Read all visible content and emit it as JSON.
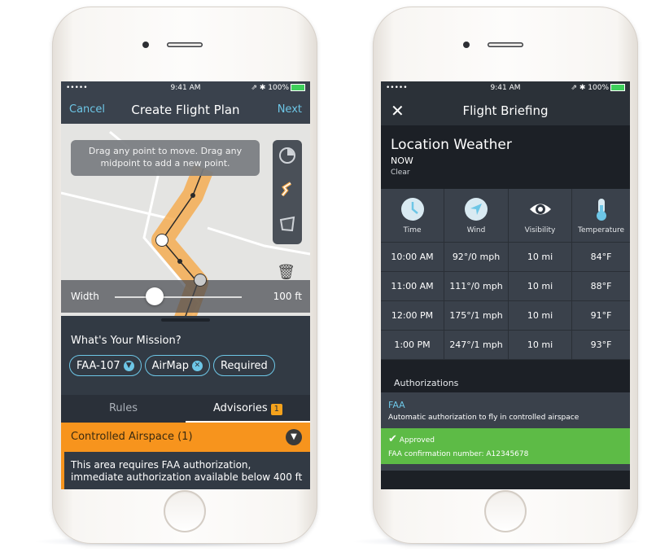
{
  "status_bar": {
    "signal": "••••• ",
    "time": "9:41 AM",
    "battery": "100%"
  },
  "left": {
    "nav": {
      "cancel": "Cancel",
      "title": "Create Flight Plan",
      "next": "Next"
    },
    "map": {
      "tooltip": "Drag any point to move. Drag any midpoint to add a new point.",
      "tools": [
        "circle-tool-icon",
        "path-tool-icon",
        "polygon-tool-icon"
      ]
    },
    "width": {
      "label": "Width",
      "value": "100 ft",
      "level": 0.33
    },
    "mission": {
      "heading": "What's Your Mission?",
      "chips": [
        "FAA-107",
        "AirMap",
        "Required"
      ]
    },
    "tabs": {
      "rules": "Rules",
      "advisories": "Advisories",
      "count": "1"
    },
    "advisory": {
      "title": "Controlled Airspace (1)",
      "body": "This area requires FAA authorization, immediate authorization available below 400 ft"
    }
  },
  "right": {
    "nav": {
      "title": "Flight Briefing"
    },
    "location": {
      "title": "Location Weather",
      "when": "NOW",
      "condition": "Clear"
    },
    "columns": [
      "Time",
      "Wind",
      "Visibility",
      "Temperature"
    ],
    "rows": [
      [
        "10:00 AM",
        "92°/0 mph",
        "10 mi",
        "84°F"
      ],
      [
        "11:00 AM",
        "111°/0 mph",
        "10 mi",
        "88°F"
      ],
      [
        "12:00 PM",
        "175°/1 mph",
        "10 mi",
        "91°F"
      ],
      [
        "1:00 PM",
        "247°/1 mph",
        "10 mi",
        "93°F"
      ]
    ],
    "authorizations": {
      "heading": "Authorizations",
      "agency": "FAA",
      "description": "Automatic authorization to fly in controlled airspace",
      "status": "Approved",
      "confirmation": "FAA confirmation number: A12345678"
    }
  },
  "colors": {
    "accent": "#6dc6e6",
    "warning": "#f7941d",
    "approved": "#5dbb46",
    "route": "#f5a94a"
  }
}
